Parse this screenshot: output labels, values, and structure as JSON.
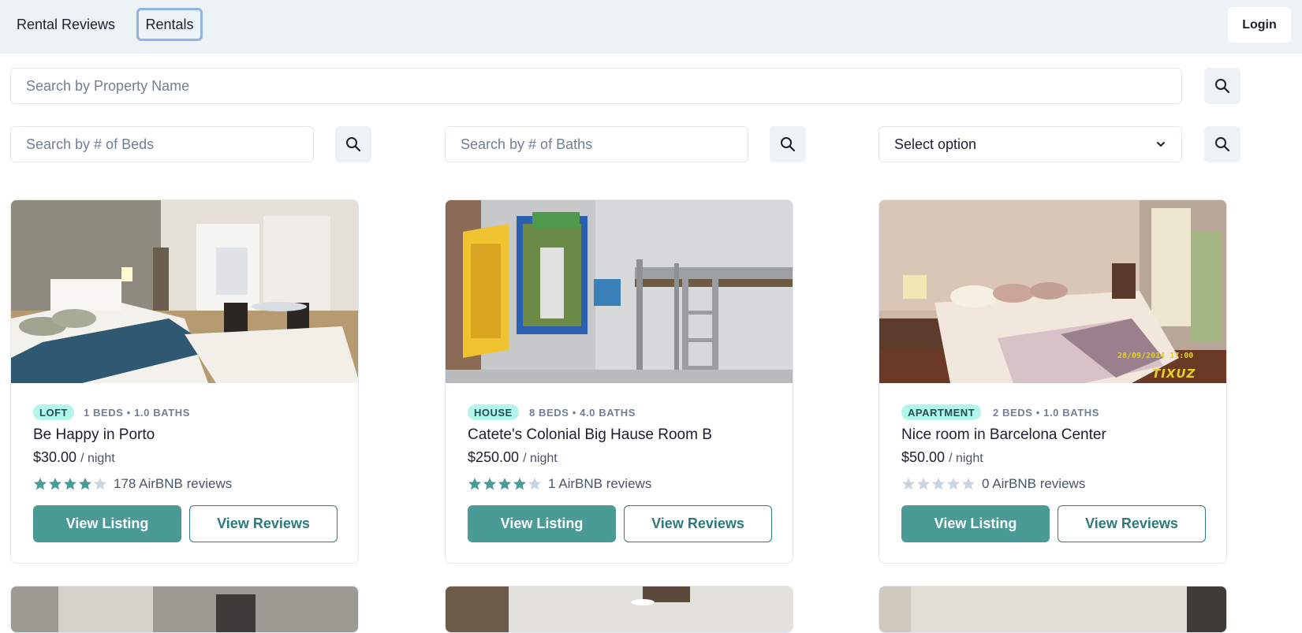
{
  "nav": {
    "brand": "Rental Reviews",
    "rentals": "Rentals",
    "login": "Login"
  },
  "search": {
    "name_placeholder": "Search by Property Name",
    "beds_placeholder": "Search by # of Beds",
    "baths_placeholder": "Search by # of Baths",
    "select_value": "Select option"
  },
  "icons": {
    "search": "search-icon",
    "select_arrow": "chevron-down-icon",
    "star": "star-icon"
  },
  "colors": {
    "accent": "#4a9b96",
    "badge_bg": "#b2f5ea",
    "star_filled": "#4a9b96",
    "star_empty": "#cbd5e0"
  },
  "listings": [
    {
      "type": "LOFT",
      "meta": "1 BEDS • 1.0 BATHS",
      "name": "Be Happy in Porto",
      "price": "$30.00",
      "per": "/ night",
      "rating": 4,
      "reviews": "178 AirBNB reviews",
      "view_listing": "View Listing",
      "view_reviews": "View Reviews"
    },
    {
      "type": "HOUSE",
      "meta": "8 BEDS • 4.0 BATHS",
      "name": "Catete's Colonial Big Hause Room B",
      "price": "$250.00",
      "per": "/ night",
      "rating": 4,
      "reviews": "1 AirBNB reviews",
      "view_listing": "View Listing",
      "view_reviews": "View Reviews"
    },
    {
      "type": "APARTMENT",
      "meta": "2 BEDS • 1.0 BATHS",
      "name": "Nice room in Barcelona Center",
      "price": "$50.00",
      "per": "/ night",
      "rating": 0,
      "reviews": "0 AirBNB reviews",
      "view_listing": "View Listing",
      "view_reviews": "View Reviews",
      "photo_stamp": "28/09/2014 17:00",
      "photo_watermark": "TIXUZ"
    }
  ]
}
